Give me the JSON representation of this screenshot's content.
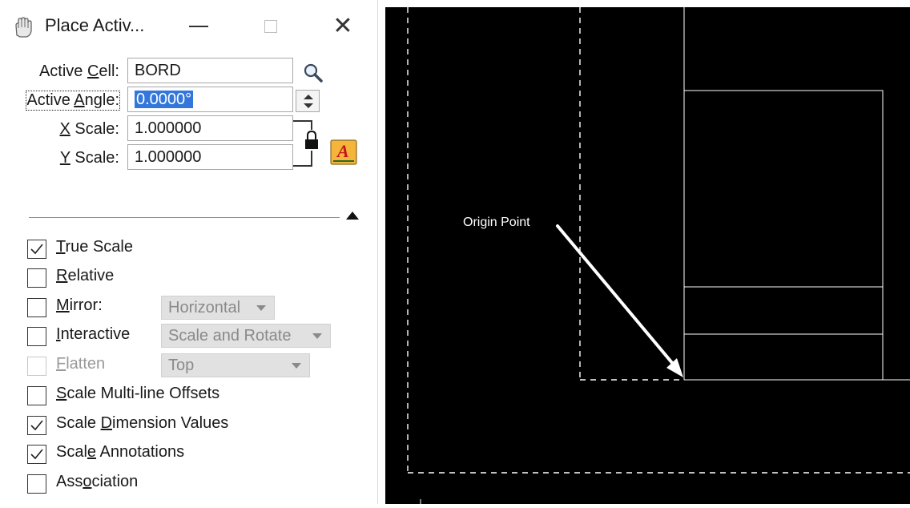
{
  "window": {
    "title": "Place Activ...",
    "icon": "cell-hand-icon",
    "controls": {
      "minimize": "minimize-icon",
      "maximize": "maximize-icon",
      "close": "close-icon"
    }
  },
  "fields": {
    "active_cell": {
      "label_pre": "Active ",
      "label_u": "C",
      "label_post": "ell:",
      "value": "BORD"
    },
    "active_angle": {
      "label_pre": "Active ",
      "label_u": "A",
      "label_post": "ngle:",
      "value": "0.0000°"
    },
    "x_scale": {
      "label_u": "X",
      "label_post": " Scale:",
      "value": "1.000000"
    },
    "y_scale": {
      "label_u": "Y",
      "label_post": " Scale:",
      "value": "1.000000"
    }
  },
  "options": {
    "true_scale": {
      "u": "T",
      "rest": "rue Scale",
      "checked": true,
      "enabled": true
    },
    "relative": {
      "u": "R",
      "rest": "elative",
      "checked": false,
      "enabled": true
    },
    "mirror": {
      "u": "M",
      "rest": "irror:",
      "checked": false,
      "enabled": true,
      "dropdown": "Horizontal"
    },
    "interactive": {
      "u": "I",
      "rest": "nteractive",
      "checked": false,
      "enabled": true,
      "dropdown": "Scale and Rotate"
    },
    "flatten": {
      "u": "F",
      "rest": "latten",
      "checked": false,
      "enabled": false,
      "dropdown": "Top"
    },
    "scale_multiline": {
      "pre": "",
      "u": "S",
      "rest": "cale Multi-line Offsets",
      "checked": false,
      "enabled": true
    },
    "scale_dimension": {
      "pre": "Scale ",
      "u": "D",
      "rest": "imension Values",
      "checked": true,
      "enabled": true
    },
    "scale_annotations": {
      "pre": "Scal",
      "u": "e",
      "rest": " Annotations",
      "checked": true,
      "enabled": true
    },
    "association": {
      "pre": "Ass",
      "u": "o",
      "rest": "ciation",
      "checked": false,
      "enabled": true
    }
  },
  "canvas": {
    "annotation": "Origin Point",
    "colors": {
      "background": "#000000",
      "lines": "#ffffff"
    }
  }
}
